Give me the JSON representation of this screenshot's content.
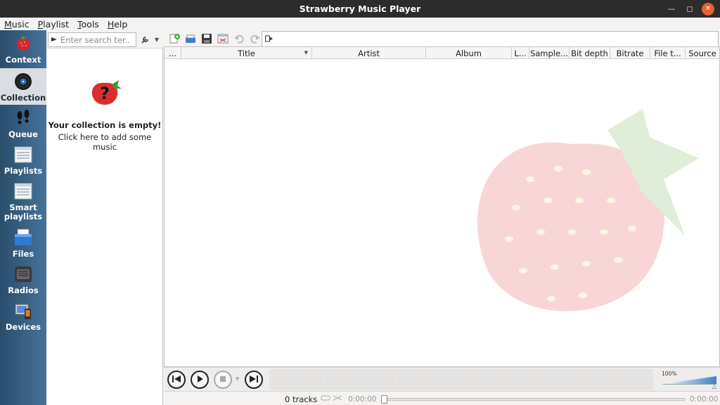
{
  "window": {
    "title": "Strawberry Music Player"
  },
  "menu": [
    {
      "label": "Music"
    },
    {
      "label": "Playlist"
    },
    {
      "label": "Tools"
    },
    {
      "label": "Help"
    }
  ],
  "sidebar": {
    "items": [
      {
        "label": "Context",
        "icon": "strawberry-icon",
        "active": false
      },
      {
        "label": "Collection",
        "icon": "vinyl-icon",
        "active": true
      },
      {
        "label": "Queue",
        "icon": "footsteps-icon",
        "active": false
      },
      {
        "label": "Playlists",
        "icon": "playlist-icon",
        "active": false
      },
      {
        "label": "Smart\nplaylists",
        "icon": "smart-playlist-icon",
        "active": false
      },
      {
        "label": "Files",
        "icon": "files-icon",
        "active": false
      },
      {
        "label": "Radios",
        "icon": "radio-icon",
        "active": false
      },
      {
        "label": "Devices",
        "icon": "devices-icon",
        "active": false
      }
    ]
  },
  "collection": {
    "search_placeholder": "Enter search ter...",
    "empty_title": "Your collection is empty!",
    "empty_link": "Click here to add some music"
  },
  "playlist": {
    "columns": [
      {
        "label": "..."
      },
      {
        "label": "Title"
      },
      {
        "label": "Artist"
      },
      {
        "label": "Album"
      },
      {
        "label": "L..."
      },
      {
        "label": "Sample..."
      },
      {
        "label": "Bit depth"
      },
      {
        "label": "Bitrate"
      },
      {
        "label": "File t..."
      },
      {
        "label": "Source"
      }
    ]
  },
  "player": {
    "volume_label": "100%",
    "volume_percent": 100
  },
  "status": {
    "tracks": "0 tracks",
    "elapsed": "0:00:00",
    "remaining": "0:00:00"
  },
  "colors": {
    "accent": "#3c82c8",
    "sidebar_dark": "#2a4d6b",
    "sidebar_light": "#46739b",
    "close_button": "#e85e2b"
  }
}
